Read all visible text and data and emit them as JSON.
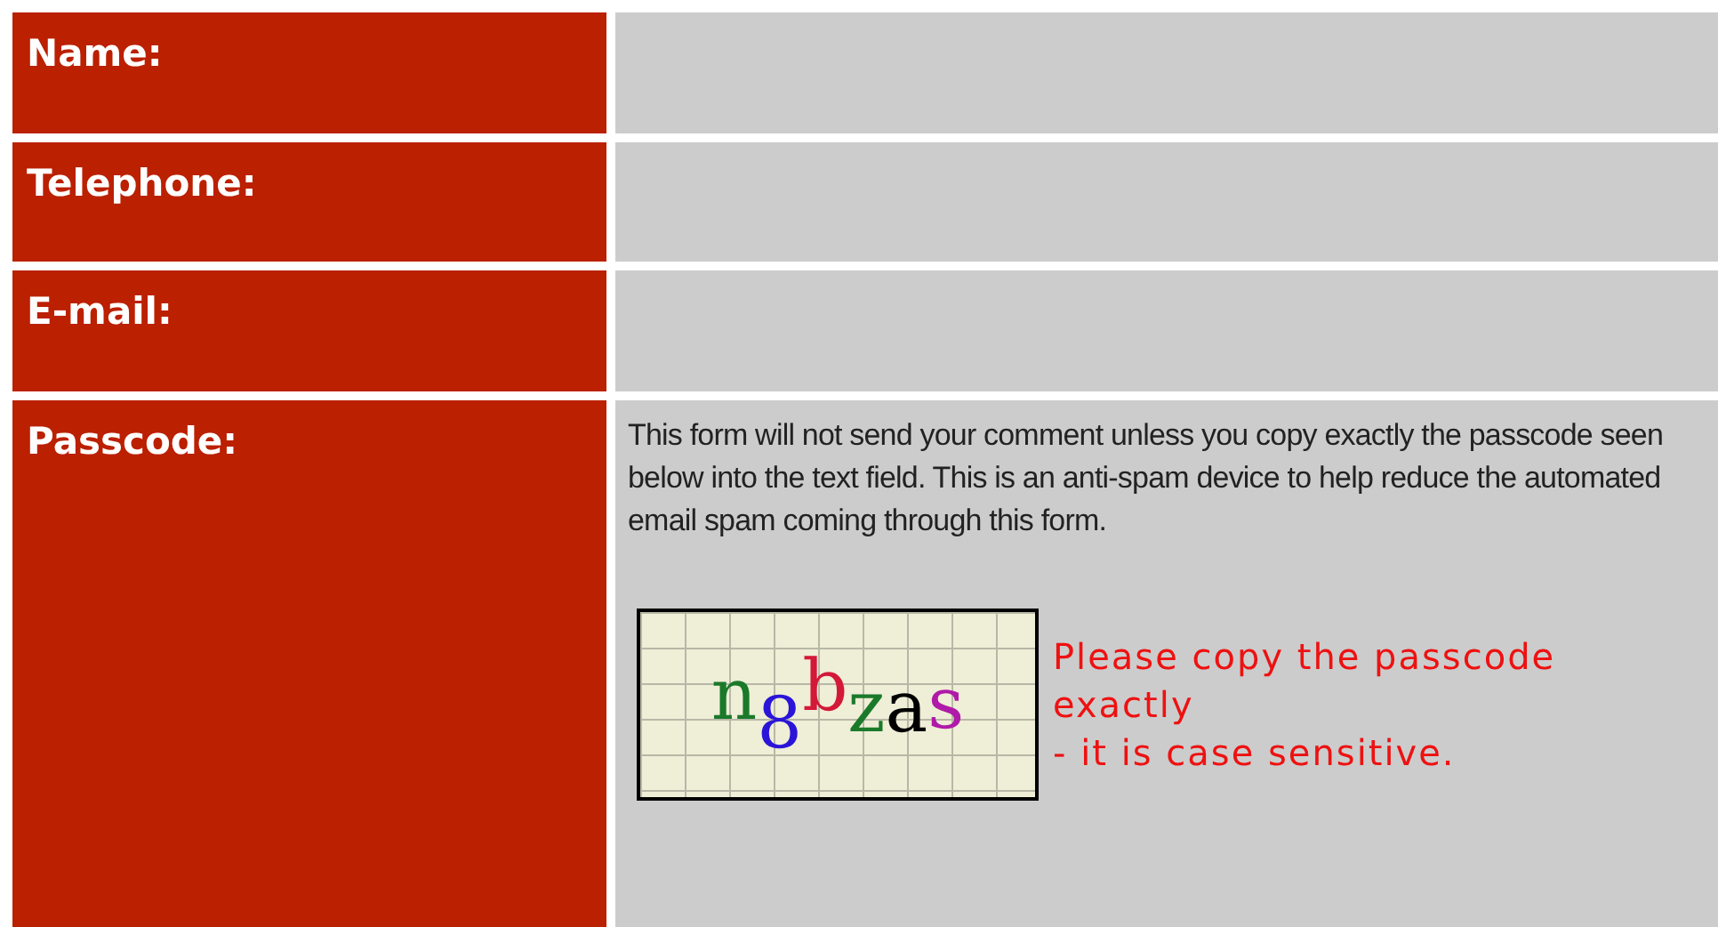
{
  "fields": [
    {
      "label": "Name:"
    },
    {
      "label": "Telephone:"
    },
    {
      "label": "E-mail:"
    }
  ],
  "passcode": {
    "label": "Passcode:",
    "description": "This form will not send your comment unless you copy exactly the passcode seen below into the text field. This is an anti-spam device to help reduce the automated email spam coming through this form.",
    "captcha": "n8bzas",
    "note": [
      "Please copy the passcode exactly",
      "- it is case sensitive."
    ]
  }
}
